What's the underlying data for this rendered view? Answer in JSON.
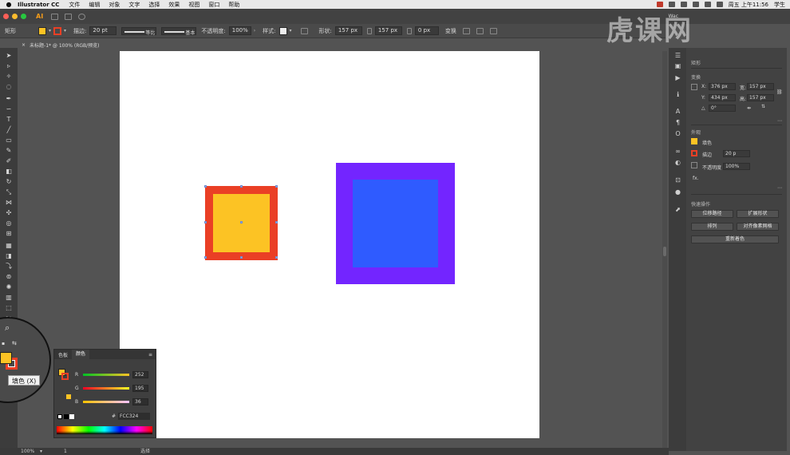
{
  "menubar": {
    "app_name": "Illustrator CC",
    "menus": [
      "文件",
      "编辑",
      "对象",
      "文字",
      "选择",
      "效果",
      "视图",
      "窗口",
      "帮助"
    ],
    "clock": "周五 上午11:56",
    "user": "学生"
  },
  "appbar": {
    "logo": "AI",
    "workspace": "Wac"
  },
  "controlbar": {
    "selection_label": "矩形",
    "fill_color": "#fcc324",
    "stroke_color": "#ea3f25",
    "stroke_label": "描边:",
    "stroke_weight": "20 pt",
    "stroke_profile": "等比",
    "brush_definition": "基本",
    "opacity_label": "不透明度:",
    "opacity_value": "100%",
    "style_label": "样式:",
    "shape_label": "形状:",
    "width_value": "157 px",
    "height_value": "157 px",
    "corner_value": "0 px",
    "transform_label": "变换"
  },
  "document": {
    "tab_title": "未标题-1* @ 100% (RGB/预览)"
  },
  "canvas": {
    "orange_square": {
      "stroke_color": "#ea3f25",
      "fill_color": "#fcc324"
    },
    "purple_square": {
      "stroke_color": "#7325ff",
      "fill_color": "#2f5bff"
    }
  },
  "toolbar": {
    "fill_tooltip": "填色 (X)"
  },
  "color_panel": {
    "tabs": [
      "色板",
      "颜色"
    ],
    "channels": [
      {
        "label": "R",
        "value": "252"
      },
      {
        "label": "G",
        "value": "195"
      },
      {
        "label": "B",
        "value": "36"
      }
    ],
    "hex_label": "#",
    "hex_value": "FCC324"
  },
  "properties": {
    "section_rect": "矩形",
    "section_transform": "变换",
    "x_label": "X:",
    "x_value": "376 px",
    "y_label": "Y:",
    "y_value": "434 px",
    "w_label": "宽:",
    "w_value": "157 px",
    "h_label": "高:",
    "h_value": "157 px",
    "rotate_value": "0°",
    "section_appearance": "外观",
    "fill_label": "填色",
    "stroke_label": "描边",
    "stroke_value": "20 p",
    "opacity_label": "不透明度",
    "opacity_value": "100%",
    "fx_label": "fx.",
    "section_quick": "快速操作",
    "buttons": [
      "位移路径",
      "扩展形状",
      "排列",
      "对齐像素网格",
      "重新着色"
    ]
  },
  "watermark": "虎课网",
  "statusbar": {
    "zoom": "100%",
    "page": "1",
    "mode": "选择"
  }
}
